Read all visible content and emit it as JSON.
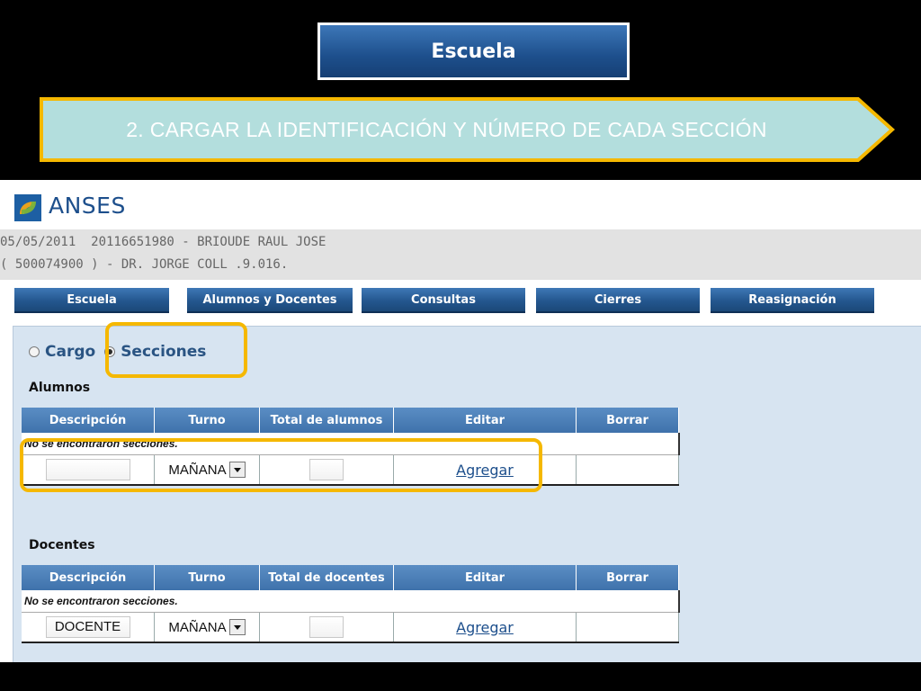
{
  "slide": {
    "title": "Escuela",
    "step": "2. CARGAR LA IDENTIFICACIÓN Y NÚMERO DE CADA SECCIÓN"
  },
  "brand": {
    "name": "ANSES",
    "logo_icon": "anses-logo-icon"
  },
  "user": {
    "line1": "05/05/2011  20116651980 - BRIOUDE RAUL JOSE",
    "line2": "( 500074900 ) - DR. JORGE COLL .9.016."
  },
  "nav": [
    "Escuela",
    "Alumnos y Docentes",
    "Consultas",
    "Cierres",
    "Reasignación"
  ],
  "mode": {
    "option_cargo": "Cargo",
    "option_secciones": "Secciones",
    "selected": "Secciones"
  },
  "alumnos": {
    "title": "Alumnos",
    "headers": [
      "Descripción",
      "Turno",
      "Total de alumnos",
      "Editar",
      "Borrar"
    ],
    "empty_message": "No se encontraron secciones.",
    "new_row": {
      "descripcion": "",
      "turno": "MAÑANA",
      "total": "",
      "action": "Agregar"
    }
  },
  "docentes": {
    "title": "Docentes",
    "headers": [
      "Descripción",
      "Turno",
      "Total de docentes",
      "Editar",
      "Borrar"
    ],
    "empty_message": "No se encontraron secciones.",
    "new_row": {
      "descripcion": "DOCENTE",
      "turno": "MAÑANA",
      "total": "",
      "action": "Agregar"
    }
  },
  "colors": {
    "nav": "#24578f",
    "panel": "#d7e4f1",
    "highlight": "#f5b800",
    "banner": "#b3dedd"
  }
}
